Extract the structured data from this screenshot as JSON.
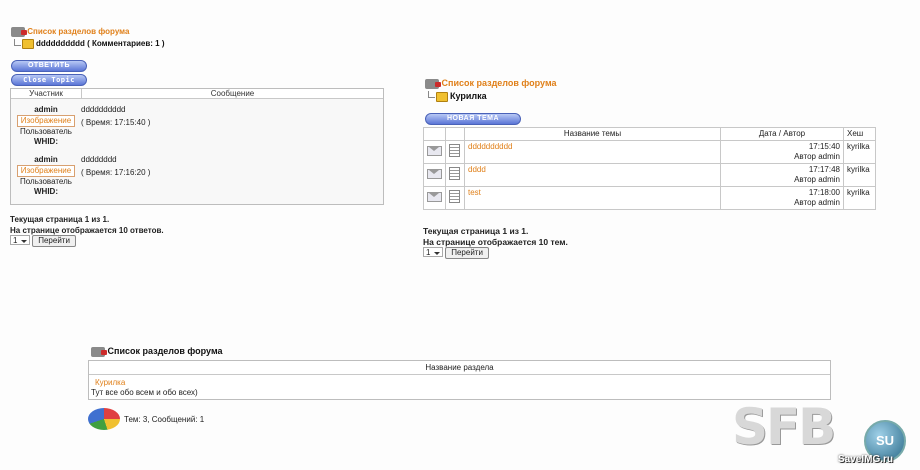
{
  "left_panel": {
    "breadcrumb_link": "Список разделов форума",
    "breadcrumb_current": "dddddddddd ( Комментариев: 1 )",
    "reply_button": "ОТВЕТИТЬ",
    "close_topic_button": "Close Topic",
    "col_participant": "Участник",
    "col_message": "Сообщение",
    "posts": [
      {
        "author": "admin",
        "image_label": "Изображение",
        "role": "Пользователь",
        "whid": "WHID:",
        "text": "dddddddddd",
        "time": "( Время: 17:15:40 )"
      },
      {
        "author": "admin",
        "image_label": "Изображение",
        "role": "Пользователь",
        "whid": "WHID:",
        "text": "dddddddd",
        "time": "( Время: 17:16:20 )"
      }
    ],
    "page_status": "Текущая страница 1 из 1.",
    "per_page": "На странице отображается 10 ответов.",
    "page_select": "1",
    "go_button": "Перейти"
  },
  "right_panel": {
    "breadcrumb_link": "Список разделов форума",
    "breadcrumb_current": "Курилка",
    "new_topic_button": "НОВАЯ ТЕМА",
    "col_topic": "Название темы",
    "col_date": "Дата / Автор",
    "col_hash": "Хеш",
    "topics": [
      {
        "title": "dddddddddd",
        "time": "17:15:40",
        "author": "Автор admin",
        "hash": "kyrilka"
      },
      {
        "title": "dddd",
        "time": "17:17:48",
        "author": "Автор admin",
        "hash": "kyrilka"
      },
      {
        "title": "test",
        "time": "17:18:00",
        "author": "Автор admin",
        "hash": "kyrilka"
      }
    ],
    "page_status": "Текущая страница 1 из 1.",
    "per_page": "На странице отображается 10 тем.",
    "page_select": "1",
    "go_button": "Перейти"
  },
  "bottom_panel": {
    "breadcrumb_title": "Список разделов форума",
    "col_section": "Название раздела",
    "section_name": "Курилка",
    "section_desc": "Тут все обо всем и обо всех)",
    "stats": "Тем: 3, Сообщений: 1"
  },
  "watermark": {
    "logo": "SFB",
    "badge": "SU",
    "url": "SaveIMG.ru"
  }
}
